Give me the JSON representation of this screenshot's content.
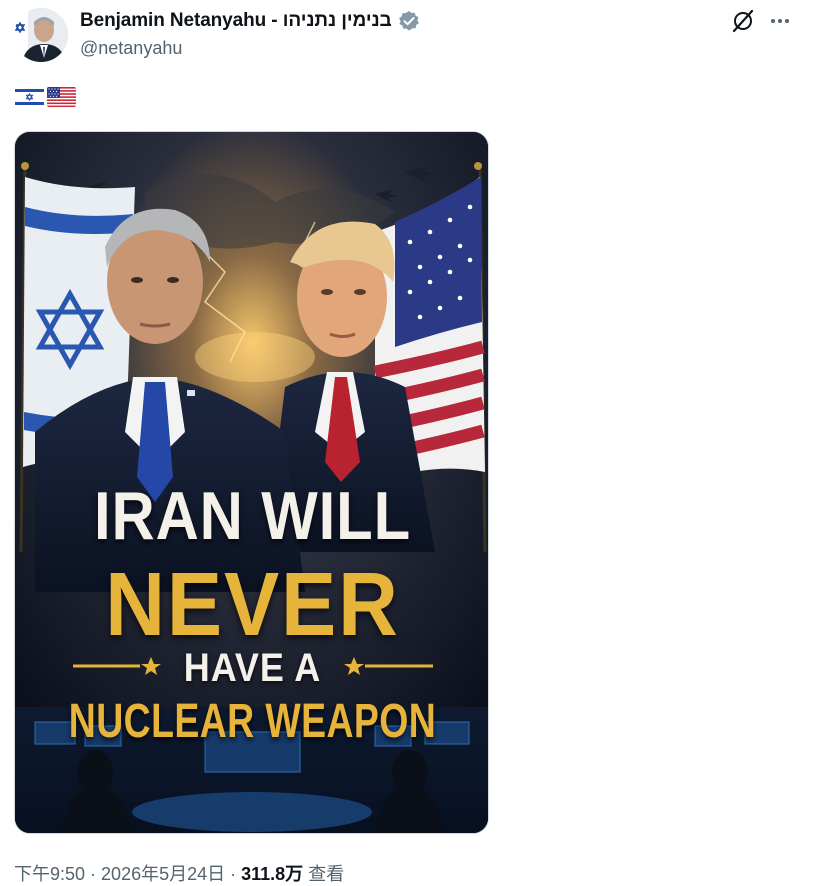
{
  "author": {
    "display_name": "Benjamin Netanyahu - בנימין נתניהו",
    "handle": "@netanyahu",
    "verified": true,
    "avatar": "portrait-avatar"
  },
  "header_actions": [
    {
      "name": "grok-icon"
    },
    {
      "name": "more-options-icon"
    }
  ],
  "post": {
    "text_flags": [
      "israel-flag",
      "usa-flag"
    ]
  },
  "media": {
    "type": "image",
    "poster_lines": [
      "IRAN WILL",
      "NEVER",
      "HAVE A",
      "NUCLEAR WEAPON"
    ]
  },
  "meta": {
    "time": "下午9:50",
    "sep1": " · ",
    "date": "2026年5月24日",
    "sep2": " · ",
    "views": "311.8万",
    "views_label": " 查看"
  },
  "colors": {
    "text_primary": "#0f1419",
    "text_secondary": "#536471",
    "verified_badge": "#829aab",
    "poster_gold": "#e7b43b",
    "poster_white": "#f4f1ea"
  }
}
